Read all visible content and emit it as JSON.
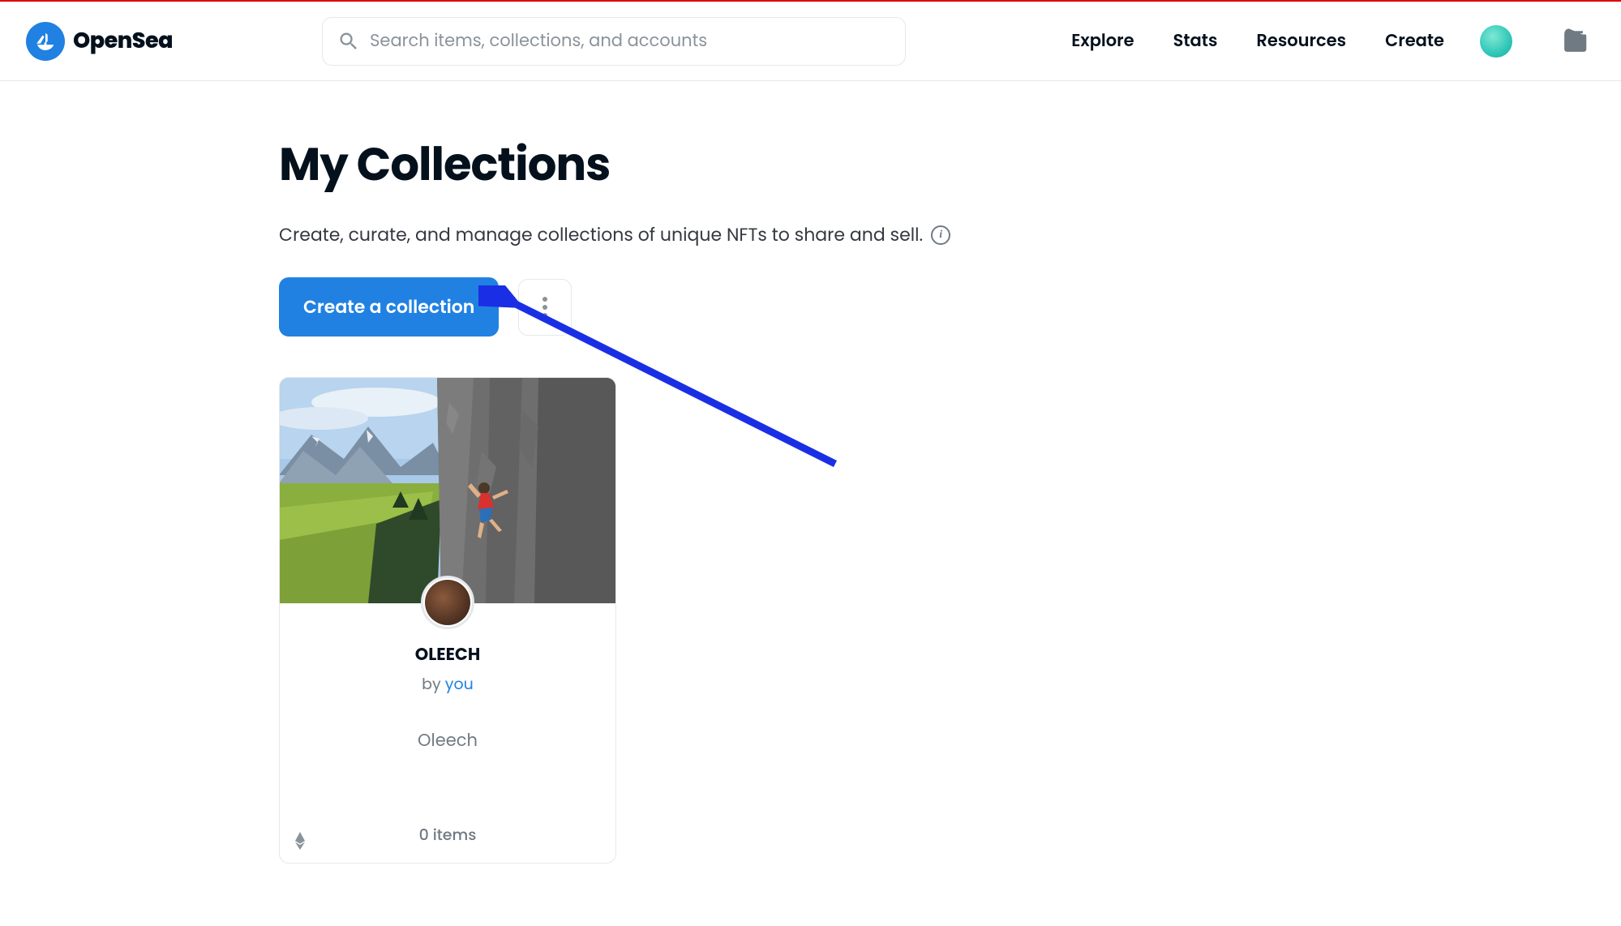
{
  "header": {
    "brand": "OpenSea",
    "search_placeholder": "Search items, collections, and accounts",
    "nav": [
      "Explore",
      "Stats",
      "Resources",
      "Create"
    ]
  },
  "page": {
    "title": "My Collections",
    "subtitle": "Create, curate, and manage collections of unique NFTs to share and sell.",
    "create_btn": "Create a collection"
  },
  "collection": {
    "name": "OLEECH",
    "by_prefix": "by ",
    "by_link": "you",
    "desc": "Oleech",
    "items_count": "0 items"
  }
}
